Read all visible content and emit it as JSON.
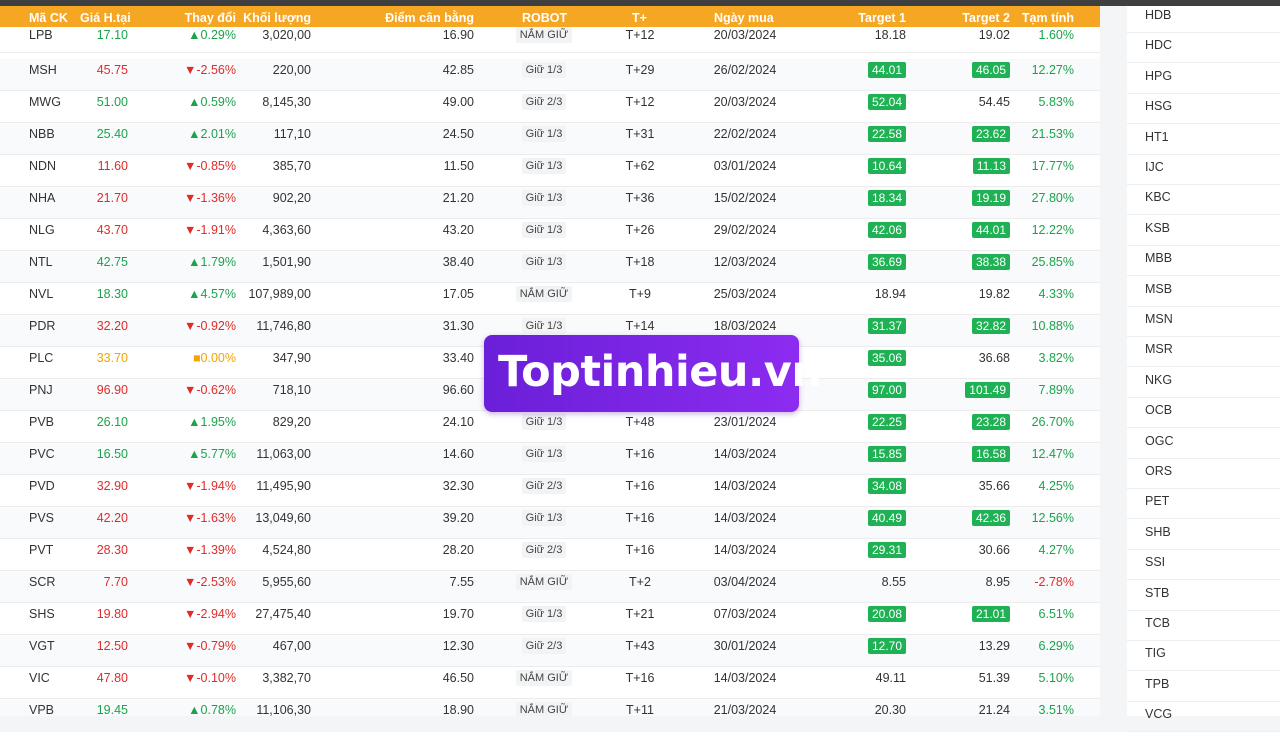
{
  "table": {
    "headers": {
      "code": "Mã CK",
      "price": "Giá H.tại",
      "change": "Thay đổi",
      "volume": "Khối lượng",
      "balance": "Điểm cân bằng",
      "robot": "ROBOT",
      "t": "T+",
      "date": "Ngày mua",
      "target1": "Target 1",
      "target2": "Target 2",
      "pct": "Tạm tính"
    },
    "rows": [
      {
        "code": "LPB",
        "price": "17.10",
        "change": "▲0.29%",
        "trend": "up",
        "volume": "3,020,00",
        "balance": "16.90",
        "robot": "NẮM GIỮ",
        "t": "T+12",
        "date": "20/03/2024",
        "t1": "18.18",
        "t1_hit": false,
        "t2": "19.02",
        "t2_hit": false,
        "pct": "1.60%",
        "pct_trend": "up"
      },
      {
        "code": "MSH",
        "price": "45.75",
        "change": "▼-2.56%",
        "trend": "down",
        "volume": "220,00",
        "balance": "42.85",
        "robot": "Giữ 1/3",
        "t": "T+29",
        "date": "26/02/2024",
        "t1": "44.01",
        "t1_hit": true,
        "t2": "46.05",
        "t2_hit": true,
        "pct": "12.27%",
        "pct_trend": "up"
      },
      {
        "code": "MWG",
        "price": "51.00",
        "change": "▲0.59%",
        "trend": "up",
        "volume": "8,145,30",
        "balance": "49.00",
        "robot": "Giữ 2/3",
        "t": "T+12",
        "date": "20/03/2024",
        "t1": "52.04",
        "t1_hit": true,
        "t2": "54.45",
        "t2_hit": false,
        "pct": "5.83%",
        "pct_trend": "up"
      },
      {
        "code": "NBB",
        "price": "25.40",
        "change": "▲2.01%",
        "trend": "up",
        "volume": "117,10",
        "balance": "24.50",
        "robot": "Giữ 1/3",
        "t": "T+31",
        "date": "22/02/2024",
        "t1": "22.58",
        "t1_hit": true,
        "t2": "23.62",
        "t2_hit": true,
        "pct": "21.53%",
        "pct_trend": "up"
      },
      {
        "code": "NDN",
        "price": "11.60",
        "change": "▼-0.85%",
        "trend": "down",
        "volume": "385,70",
        "balance": "11.50",
        "robot": "Giữ 1/3",
        "t": "T+62",
        "date": "03/01/2024",
        "t1": "10.64",
        "t1_hit": true,
        "t2": "11.13",
        "t2_hit": true,
        "pct": "17.77%",
        "pct_trend": "up"
      },
      {
        "code": "NHA",
        "price": "21.70",
        "change": "▼-1.36%",
        "trend": "down",
        "volume": "902,20",
        "balance": "21.20",
        "robot": "Giữ 1/3",
        "t": "T+36",
        "date": "15/02/2024",
        "t1": "18.34",
        "t1_hit": true,
        "t2": "19.19",
        "t2_hit": true,
        "pct": "27.80%",
        "pct_trend": "up"
      },
      {
        "code": "NLG",
        "price": "43.70",
        "change": "▼-1.91%",
        "trend": "down",
        "volume": "4,363,60",
        "balance": "43.20",
        "robot": "Giữ 1/3",
        "t": "T+26",
        "date": "29/02/2024",
        "t1": "42.06",
        "t1_hit": true,
        "t2": "44.01",
        "t2_hit": true,
        "pct": "12.22%",
        "pct_trend": "up"
      },
      {
        "code": "NTL",
        "price": "42.75",
        "change": "▲1.79%",
        "trend": "up",
        "volume": "1,501,90",
        "balance": "38.40",
        "robot": "Giữ 1/3",
        "t": "T+18",
        "date": "12/03/2024",
        "t1": "36.69",
        "t1_hit": true,
        "t2": "38.38",
        "t2_hit": true,
        "pct": "25.85%",
        "pct_trend": "up"
      },
      {
        "code": "NVL",
        "price": "18.30",
        "change": "▲4.57%",
        "trend": "up",
        "volume": "107,989,00",
        "balance": "17.05",
        "robot": "NẮM GIỮ",
        "t": "T+9",
        "date": "25/03/2024",
        "t1": "18.94",
        "t1_hit": false,
        "t2": "19.82",
        "t2_hit": false,
        "pct": "4.33%",
        "pct_trend": "up"
      },
      {
        "code": "PDR",
        "price": "32.20",
        "change": "▼-0.92%",
        "trend": "down",
        "volume": "11,746,80",
        "balance": "31.30",
        "robot": "Giữ 1/3",
        "t": "T+14",
        "date": "18/03/2024",
        "t1": "31.37",
        "t1_hit": true,
        "t2": "32.82",
        "t2_hit": true,
        "pct": "10.88%",
        "pct_trend": "up"
      },
      {
        "code": "PLC",
        "price": "33.70",
        "change": "■0.00%",
        "trend": "ref",
        "volume": "347,90",
        "balance": "33.40",
        "robot": "",
        "t": "",
        "date": "",
        "t1": "35.06",
        "t1_hit": true,
        "t2": "36.68",
        "t2_hit": false,
        "pct": "3.82%",
        "pct_trend": "up"
      },
      {
        "code": "PNJ",
        "price": "96.90",
        "change": "▼-0.62%",
        "trend": "down",
        "volume": "718,10",
        "balance": "96.60",
        "robot": "",
        "t": "",
        "date": "",
        "t1": "97.00",
        "t1_hit": true,
        "t2": "101.49",
        "t2_hit": true,
        "pct": "7.89%",
        "pct_trend": "up"
      },
      {
        "code": "PVB",
        "price": "26.10",
        "change": "▲1.95%",
        "trend": "up",
        "volume": "829,20",
        "balance": "24.10",
        "robot": "Giữ 1/3",
        "t": "T+48",
        "date": "23/01/2024",
        "t1": "22.25",
        "t1_hit": true,
        "t2": "23.28",
        "t2_hit": true,
        "pct": "26.70%",
        "pct_trend": "up"
      },
      {
        "code": "PVC",
        "price": "16.50",
        "change": "▲5.77%",
        "trend": "up",
        "volume": "11,063,00",
        "balance": "14.60",
        "robot": "Giữ 1/3",
        "t": "T+16",
        "date": "14/03/2024",
        "t1": "15.85",
        "t1_hit": true,
        "t2": "16.58",
        "t2_hit": true,
        "pct": "12.47%",
        "pct_trend": "up"
      },
      {
        "code": "PVD",
        "price": "32.90",
        "change": "▼-1.94%",
        "trend": "down",
        "volume": "11,495,90",
        "balance": "32.30",
        "robot": "Giữ 2/3",
        "t": "T+16",
        "date": "14/03/2024",
        "t1": "34.08",
        "t1_hit": true,
        "t2": "35.66",
        "t2_hit": false,
        "pct": "4.25%",
        "pct_trend": "up"
      },
      {
        "code": "PVS",
        "price": "42.20",
        "change": "▼-1.63%",
        "trend": "down",
        "volume": "13,049,60",
        "balance": "39.20",
        "robot": "Giữ 1/3",
        "t": "T+16",
        "date": "14/03/2024",
        "t1": "40.49",
        "t1_hit": true,
        "t2": "42.36",
        "t2_hit": true,
        "pct": "12.56%",
        "pct_trend": "up"
      },
      {
        "code": "PVT",
        "price": "28.30",
        "change": "▼-1.39%",
        "trend": "down",
        "volume": "4,524,80",
        "balance": "28.20",
        "robot": "Giữ 2/3",
        "t": "T+16",
        "date": "14/03/2024",
        "t1": "29.31",
        "t1_hit": true,
        "t2": "30.66",
        "t2_hit": false,
        "pct": "4.27%",
        "pct_trend": "up"
      },
      {
        "code": "SCR",
        "price": "7.70",
        "change": "▼-2.53%",
        "trend": "down",
        "volume": "5,955,60",
        "balance": "7.55",
        "robot": "NẮM GIỮ",
        "t": "T+2",
        "date": "03/04/2024",
        "t1": "8.55",
        "t1_hit": false,
        "t2": "8.95",
        "t2_hit": false,
        "pct": "-2.78%",
        "pct_trend": "down"
      },
      {
        "code": "SHS",
        "price": "19.80",
        "change": "▼-2.94%",
        "trend": "down",
        "volume": "27,475,40",
        "balance": "19.70",
        "robot": "Giữ 1/3",
        "t": "T+21",
        "date": "07/03/2024",
        "t1": "20.08",
        "t1_hit": true,
        "t2": "21.01",
        "t2_hit": true,
        "pct": "6.51%",
        "pct_trend": "up"
      },
      {
        "code": "VGT",
        "price": "12.50",
        "change": "▼-0.79%",
        "trend": "down",
        "volume": "467,00",
        "balance": "12.30",
        "robot": "Giữ 2/3",
        "t": "T+43",
        "date": "30/01/2024",
        "t1": "12.70",
        "t1_hit": true,
        "t2": "13.29",
        "t2_hit": false,
        "pct": "6.29%",
        "pct_trend": "up"
      },
      {
        "code": "VIC",
        "price": "47.80",
        "change": "▼-0.10%",
        "trend": "down",
        "volume": "3,382,70",
        "balance": "46.50",
        "robot": "NẮM GIỮ",
        "t": "T+16",
        "date": "14/03/2024",
        "t1": "49.11",
        "t1_hit": false,
        "t2": "51.39",
        "t2_hit": false,
        "pct": "5.10%",
        "pct_trend": "up"
      },
      {
        "code": "VPB",
        "price": "19.45",
        "change": "▲0.78%",
        "trend": "up",
        "volume": "11,106,30",
        "balance": "18.90",
        "robot": "NẮM GIỮ",
        "t": "T+11",
        "date": "21/03/2024",
        "t1": "20.30",
        "t1_hit": false,
        "t2": "21.24",
        "t2_hit": false,
        "pct": "3.51%",
        "pct_trend": "up"
      }
    ]
  },
  "sidebar": {
    "items": [
      "HDB",
      "HDC",
      "HPG",
      "HSG",
      "HT1",
      "IJC",
      "KBC",
      "KSB",
      "MBB",
      "MSB",
      "MSN",
      "MSR",
      "NKG",
      "OCB",
      "OGC",
      "ORS",
      "PET",
      "SHB",
      "SSI",
      "STB",
      "TCB",
      "TIG",
      "TPB",
      "VCG"
    ]
  },
  "watermark": {
    "text": "Toptinhieu.vn"
  },
  "colors": {
    "header": "#f5a623",
    "up": "#1aa34a",
    "down": "#e02b2b",
    "ref": "#f0a500",
    "badge": "#1fb254",
    "watermark": "#7b22e6"
  }
}
